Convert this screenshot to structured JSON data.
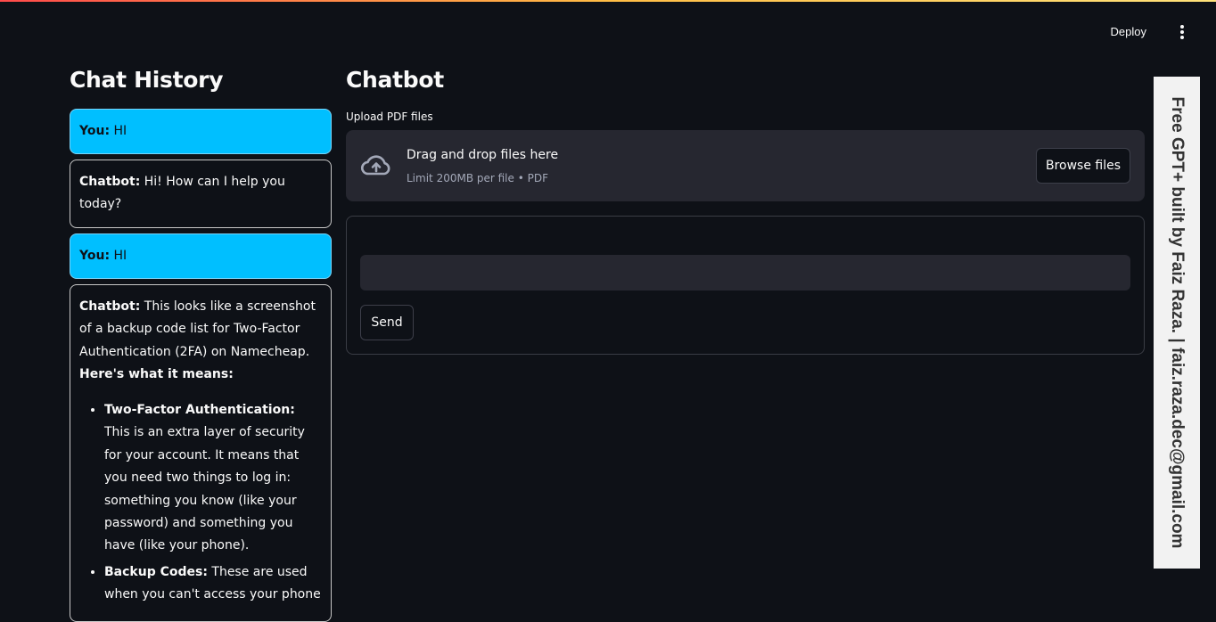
{
  "header": {
    "deploy_label": "Deploy",
    "menu_icon": "kebab-menu-icon"
  },
  "history": {
    "title": "Chat History",
    "messages": [
      {
        "role": "user",
        "speaker": "You:",
        "text": "HI"
      },
      {
        "role": "bot",
        "speaker": "Chatbot:",
        "text": "Hi! How can I help you today?"
      },
      {
        "role": "user",
        "speaker": "You:",
        "text": "HI"
      },
      {
        "role": "bot",
        "speaker": "Chatbot:",
        "text": "This looks like a screenshot of a backup code list for Two-Factor Authentication (2FA) on Namecheap.",
        "bold_line": "Here's what it means:",
        "bullets": [
          {
            "term": "Two-Factor Authentication:",
            "text": "This is an extra layer of security for your account. It means that you need two things to log in: something you know (like your password) and something you have (like your phone)."
          },
          {
            "term": "Backup Codes:",
            "text": "These are used when you can't access your phone"
          }
        ]
      }
    ]
  },
  "main": {
    "title": "Chatbot",
    "upload": {
      "label": "Upload PDF files",
      "drop_text": "Drag and drop files here",
      "limit_text": "Limit 200MB per file • PDF",
      "browse_label": "Browse files",
      "icon": "cloud-upload-icon"
    },
    "form": {
      "input_value": "",
      "send_label": "Send"
    }
  },
  "banner": {
    "text": "Free GPT+ built by Faiz Raza. | faiz.raza.dec@gmail.com"
  },
  "colors": {
    "user_bubble": "#00bfff",
    "background": "#0e1117",
    "widget": "#262730"
  }
}
